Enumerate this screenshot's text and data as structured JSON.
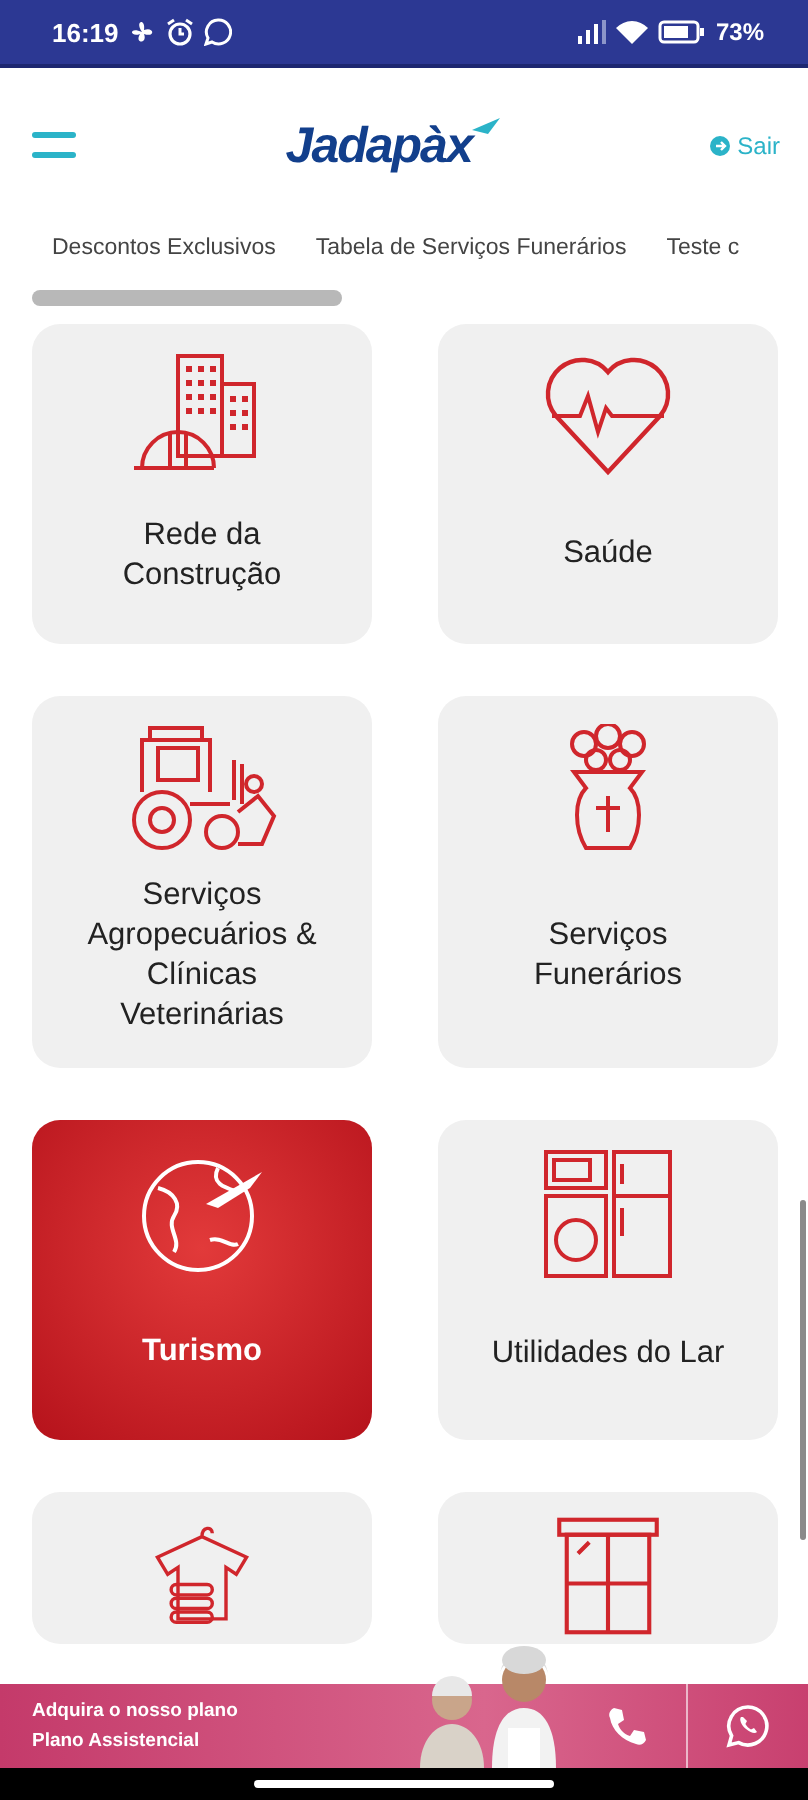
{
  "status_bar": {
    "time": "16:19",
    "battery": "73%"
  },
  "header": {
    "logo": "Jadapàx",
    "logout": "Sair"
  },
  "tabs": [
    {
      "label": "Descontos Exclusivos",
      "selected": false
    },
    {
      "label": "Tabela de Serviços Funerários",
      "selected": false
    },
    {
      "label": "Teste c",
      "selected": false
    }
  ],
  "cards": [
    {
      "label": "Rede da Construção",
      "selected": false
    },
    {
      "label": "Saúde",
      "selected": false
    },
    {
      "label": "Serviços Agropecuários & Clínicas Veterinárias",
      "selected": false
    },
    {
      "label": "Serviços Funerários",
      "selected": false
    },
    {
      "label": "Turismo",
      "selected": true
    },
    {
      "label": "Utilidades do Lar",
      "selected": false
    },
    {
      "selected": false
    },
    {
      "selected": false
    }
  ],
  "banner": {
    "line_1": "Adquira o nosso plano",
    "line_2": "Plano Assistencial"
  }
}
